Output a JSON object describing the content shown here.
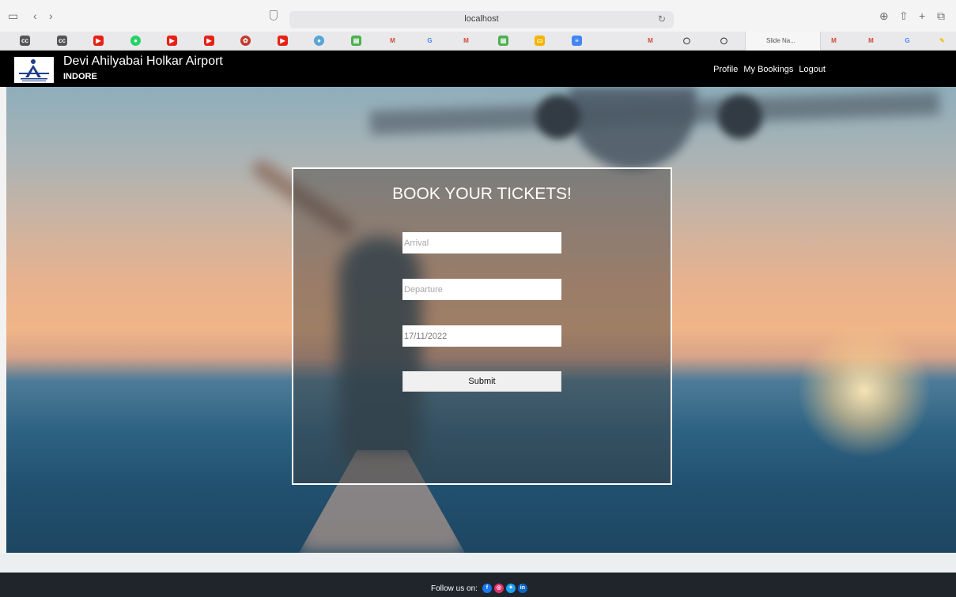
{
  "browser": {
    "url": "localhost",
    "active_tab_label": "Slide Na..."
  },
  "header": {
    "title": "Devi Ahilyabai Holkar Airport",
    "subtitle": "INDORE",
    "nav": [
      {
        "label": "Profile"
      },
      {
        "label": "My Bookings"
      },
      {
        "label": "Logout"
      }
    ]
  },
  "booking": {
    "title": "BOOK YOUR TICKETS!",
    "arrival_placeholder": "Arrival",
    "departure_placeholder": "Departure",
    "date_value": "17/11/2022",
    "submit_label": "Submit"
  },
  "footer": {
    "follow_text": "Follow us on:",
    "social": [
      {
        "icon": "facebook-icon",
        "color": "#1877f2"
      },
      {
        "icon": "instagram-icon",
        "color": "#e1306c"
      },
      {
        "icon": "twitter-icon",
        "color": "#1da1f2"
      },
      {
        "icon": "linkedin-icon",
        "color": "#0a66c2"
      }
    ]
  },
  "colors": {
    "header_bg": "#000000",
    "footer_bg": "#20252c",
    "card_border": "#ffffff"
  }
}
